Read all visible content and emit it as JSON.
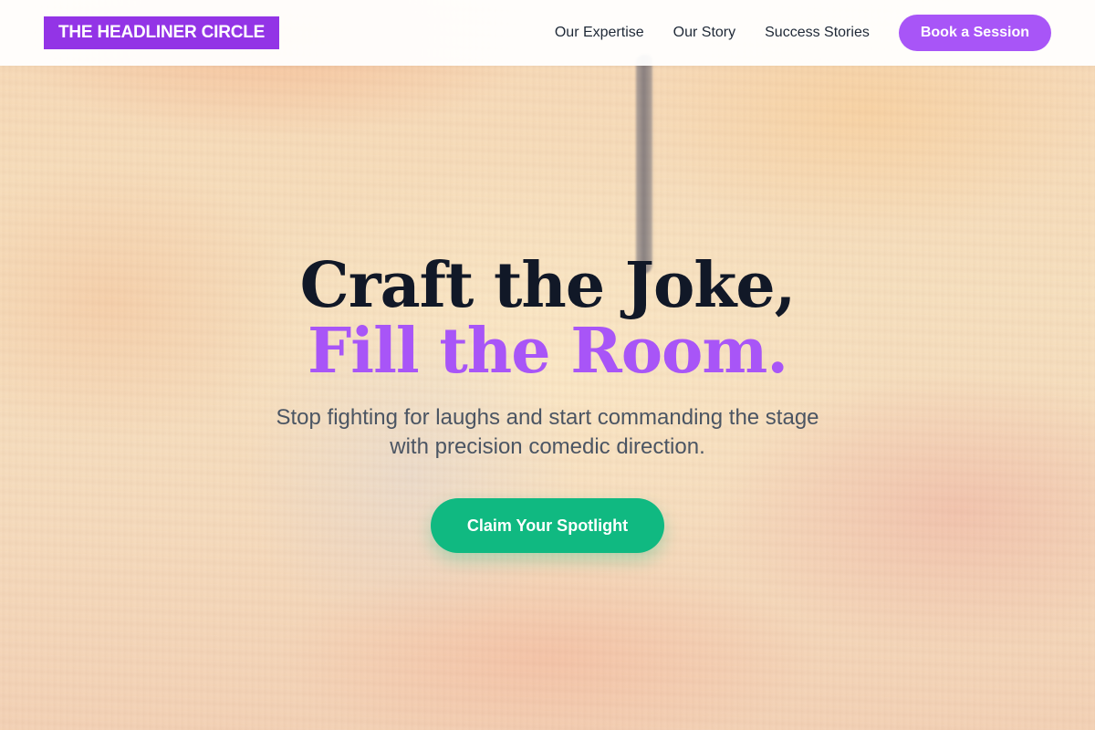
{
  "header": {
    "logo_text": "THE HEADLINER CIRCLE",
    "nav": [
      {
        "label": "Our Expertise"
      },
      {
        "label": "Our Story"
      },
      {
        "label": "Success Stories"
      }
    ],
    "cta_label": "Book a Session"
  },
  "hero": {
    "headline_line_1": "Craft the Joke,",
    "headline_line_2": "Fill the Room.",
    "subheadline": "Stop fighting for laughs and start commanding the stage with precision comedic direction.",
    "cta_label": "Claim Your Spotlight"
  },
  "colors": {
    "brand_purple": "#9334e6",
    "accent_purple": "#a855f7",
    "cta_green": "#10b981",
    "headline_dark": "#111827",
    "body_gray": "#4b5563"
  }
}
